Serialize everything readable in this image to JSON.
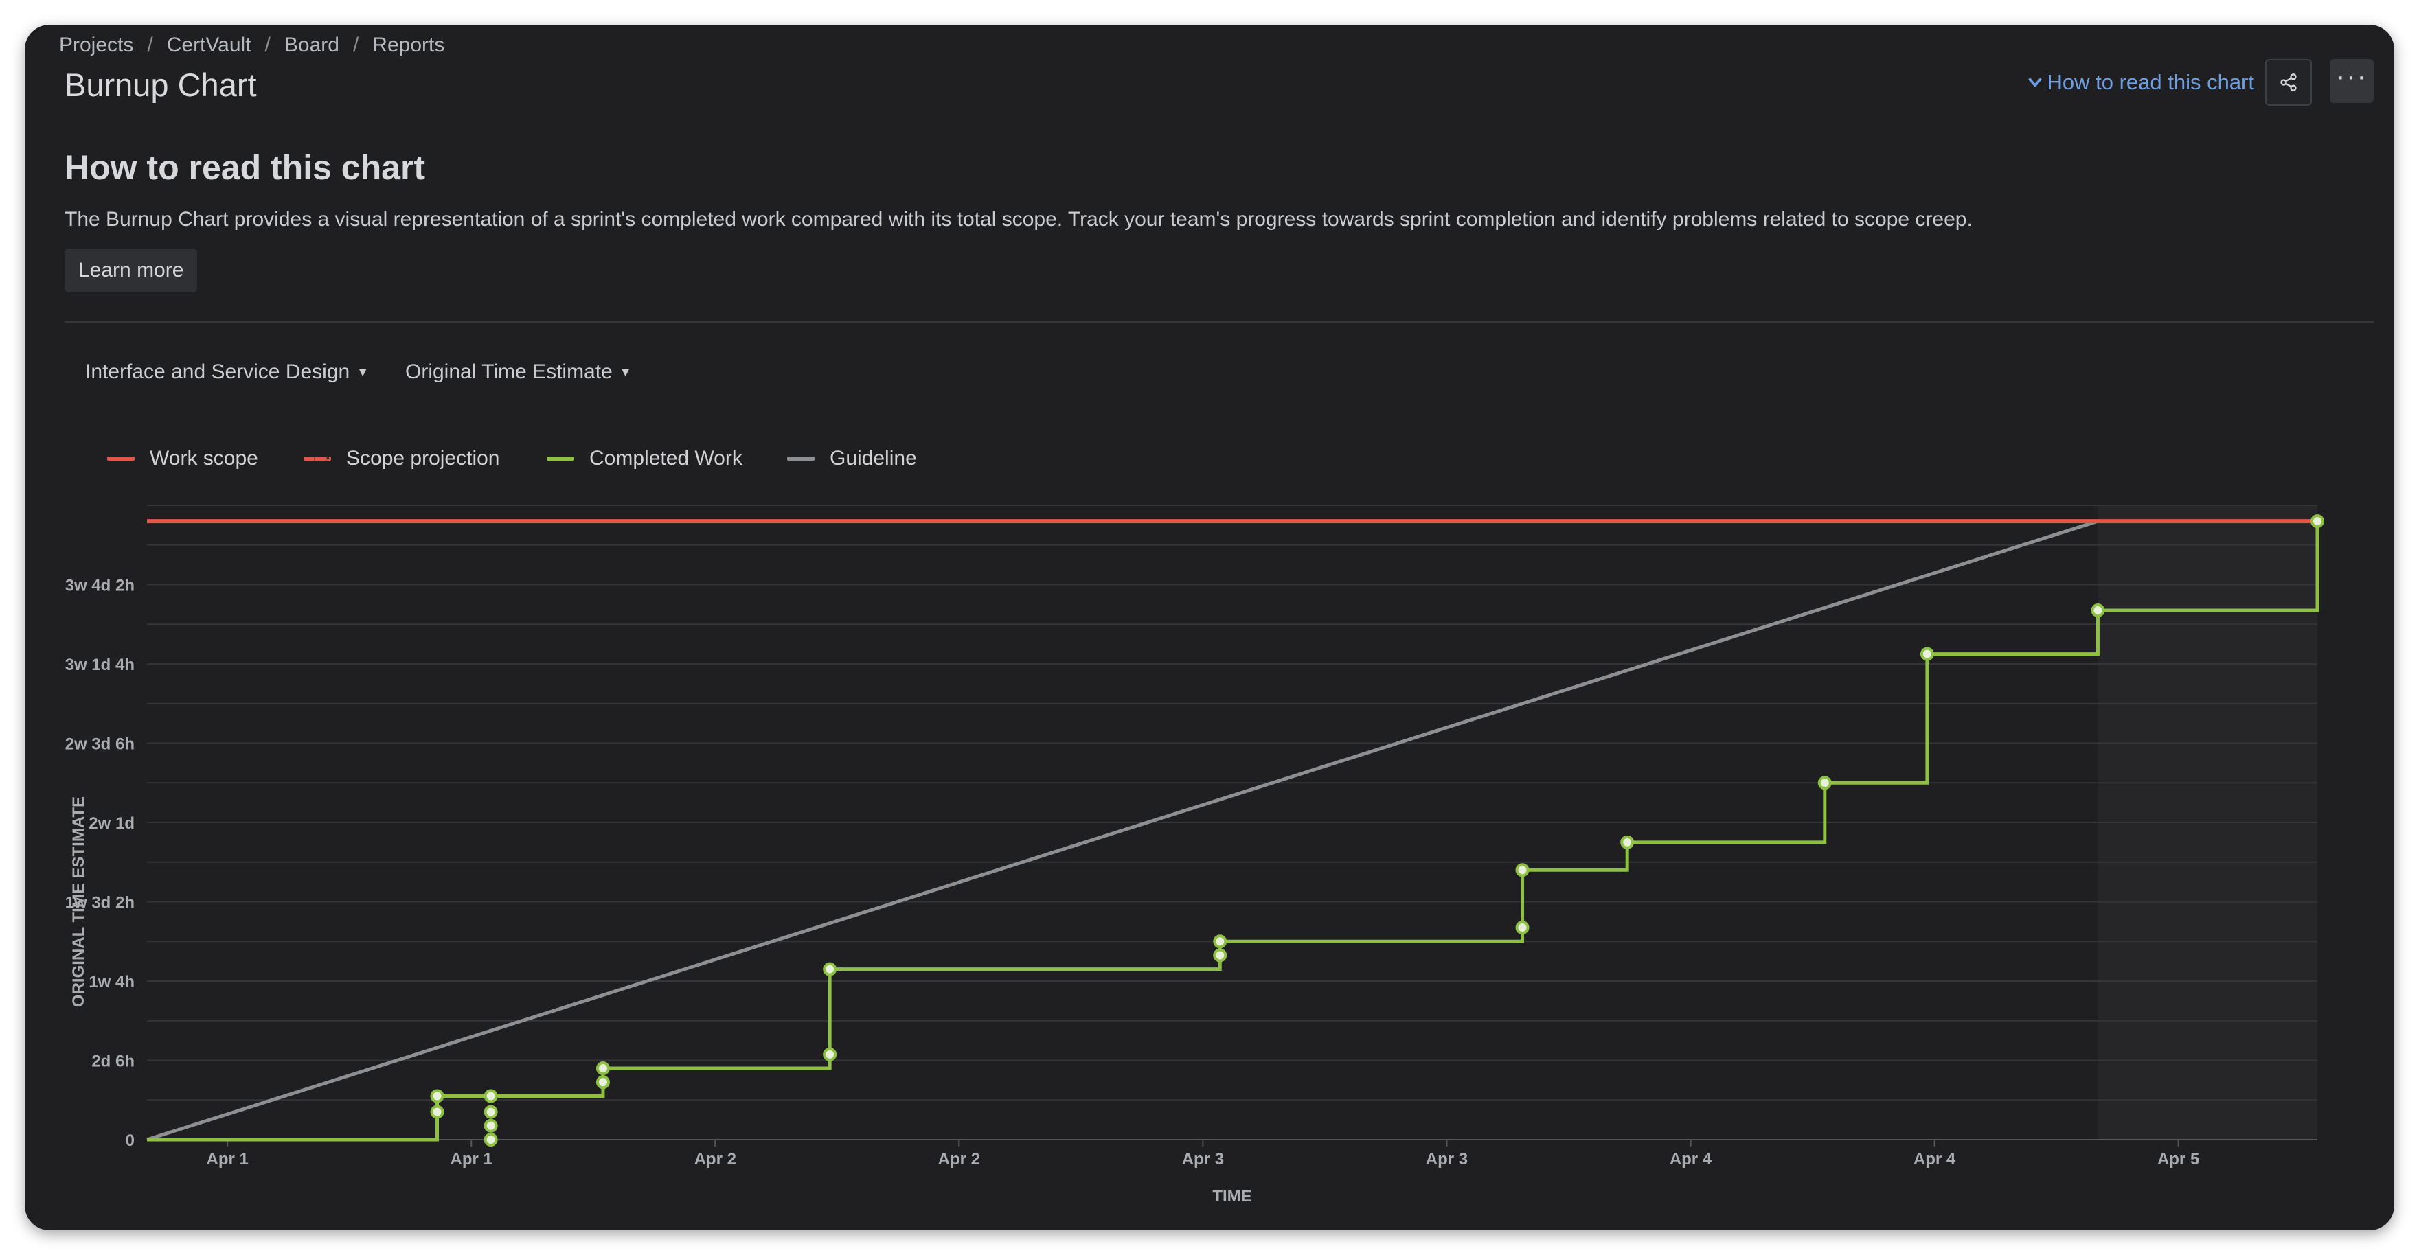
{
  "breadcrumb": [
    "Projects",
    "CertVault",
    "Board",
    "Reports"
  ],
  "page_title": "Burnup Chart",
  "help_link": "How to read this chart",
  "how_heading": "How to read this chart",
  "how_desc": "The Burnup Chart provides a visual representation of a sprint's completed work compared with its total scope. Track your team's progress towards sprint completion and identify problems related to scope creep.",
  "learn_more": "Learn more",
  "filters": {
    "board": "Interface and Service Design",
    "estimate": "Original Time Estimate"
  },
  "icons": {
    "share": "share-icon",
    "more": "more-icon",
    "chevron": "chevron-down-icon"
  },
  "colors": {
    "work_scope": "#e2574c",
    "completed": "#8dc043",
    "guideline": "#8e8f92",
    "link": "#6f9fe3"
  },
  "chart_data": {
    "type": "line",
    "xlabel": "TIME",
    "ylabel": "ORIGINAL TIME ESTIMATE",
    "ylim": [
      0,
      640
    ],
    "xlim": [
      0,
      890
    ],
    "y_ticks": [
      {
        "value": 0,
        "label": "0"
      },
      {
        "value": 80,
        "label": "2d 6h"
      },
      {
        "value": 160,
        "label": "1w 4h"
      },
      {
        "value": 240,
        "label": "1w 3d 2h"
      },
      {
        "value": 320,
        "label": "2w 1d"
      },
      {
        "value": 400,
        "label": "2w 3d 6h"
      },
      {
        "value": 480,
        "label": "3w 1d 4h"
      },
      {
        "value": 560,
        "label": "3w 4d 2h"
      }
    ],
    "x_ticks": [
      {
        "value": 33,
        "label": "Apr 1"
      },
      {
        "value": 133,
        "label": "Apr 1"
      },
      {
        "value": 233,
        "label": "Apr 2"
      },
      {
        "value": 333,
        "label": "Apr 2"
      },
      {
        "value": 433,
        "label": "Apr 3"
      },
      {
        "value": 533,
        "label": "Apr 3"
      },
      {
        "value": 633,
        "label": "Apr 4"
      },
      {
        "value": 733,
        "label": "Apr 4"
      },
      {
        "value": 833,
        "label": "Apr 5"
      }
    ],
    "legend_position": "top-left",
    "grid": true,
    "non_working_from": 800,
    "series": [
      {
        "name": "Work scope",
        "style": "solid",
        "x": [
          0,
          890
        ],
        "y": [
          624,
          624
        ]
      },
      {
        "name": "Scope projection",
        "style": "dashed",
        "x": [],
        "y": []
      },
      {
        "name": "Completed Work",
        "style": "step",
        "x": [
          0,
          119,
          119,
          141,
          141,
          187,
          187,
          280,
          280,
          440,
          440,
          564,
          564,
          607,
          607,
          688,
          688,
          730,
          730,
          800,
          800,
          890,
          890
        ],
        "y": [
          0,
          0,
          44,
          44,
          44,
          44,
          72,
          72,
          172,
          172,
          200,
          200,
          272,
          272,
          300,
          300,
          360,
          360,
          490,
          490,
          534,
          534,
          624
        ]
      },
      {
        "name": "Guideline",
        "style": "solid",
        "x": [
          0,
          800
        ],
        "y": [
          0,
          624
        ]
      }
    ],
    "points": [
      {
        "x": 119,
        "y": 28
      },
      {
        "x": 119,
        "y": 44
      },
      {
        "x": 141,
        "y": 0
      },
      {
        "x": 141,
        "y": 14
      },
      {
        "x": 141,
        "y": 28
      },
      {
        "x": 141,
        "y": 44
      },
      {
        "x": 187,
        "y": 58
      },
      {
        "x": 187,
        "y": 72
      },
      {
        "x": 280,
        "y": 86
      },
      {
        "x": 280,
        "y": 172
      },
      {
        "x": 440,
        "y": 186
      },
      {
        "x": 440,
        "y": 200
      },
      {
        "x": 564,
        "y": 214
      },
      {
        "x": 564,
        "y": 272
      },
      {
        "x": 607,
        "y": 300
      },
      {
        "x": 688,
        "y": 360
      },
      {
        "x": 730,
        "y": 490
      },
      {
        "x": 800,
        "y": 534
      },
      {
        "x": 890,
        "y": 624
      }
    ]
  }
}
